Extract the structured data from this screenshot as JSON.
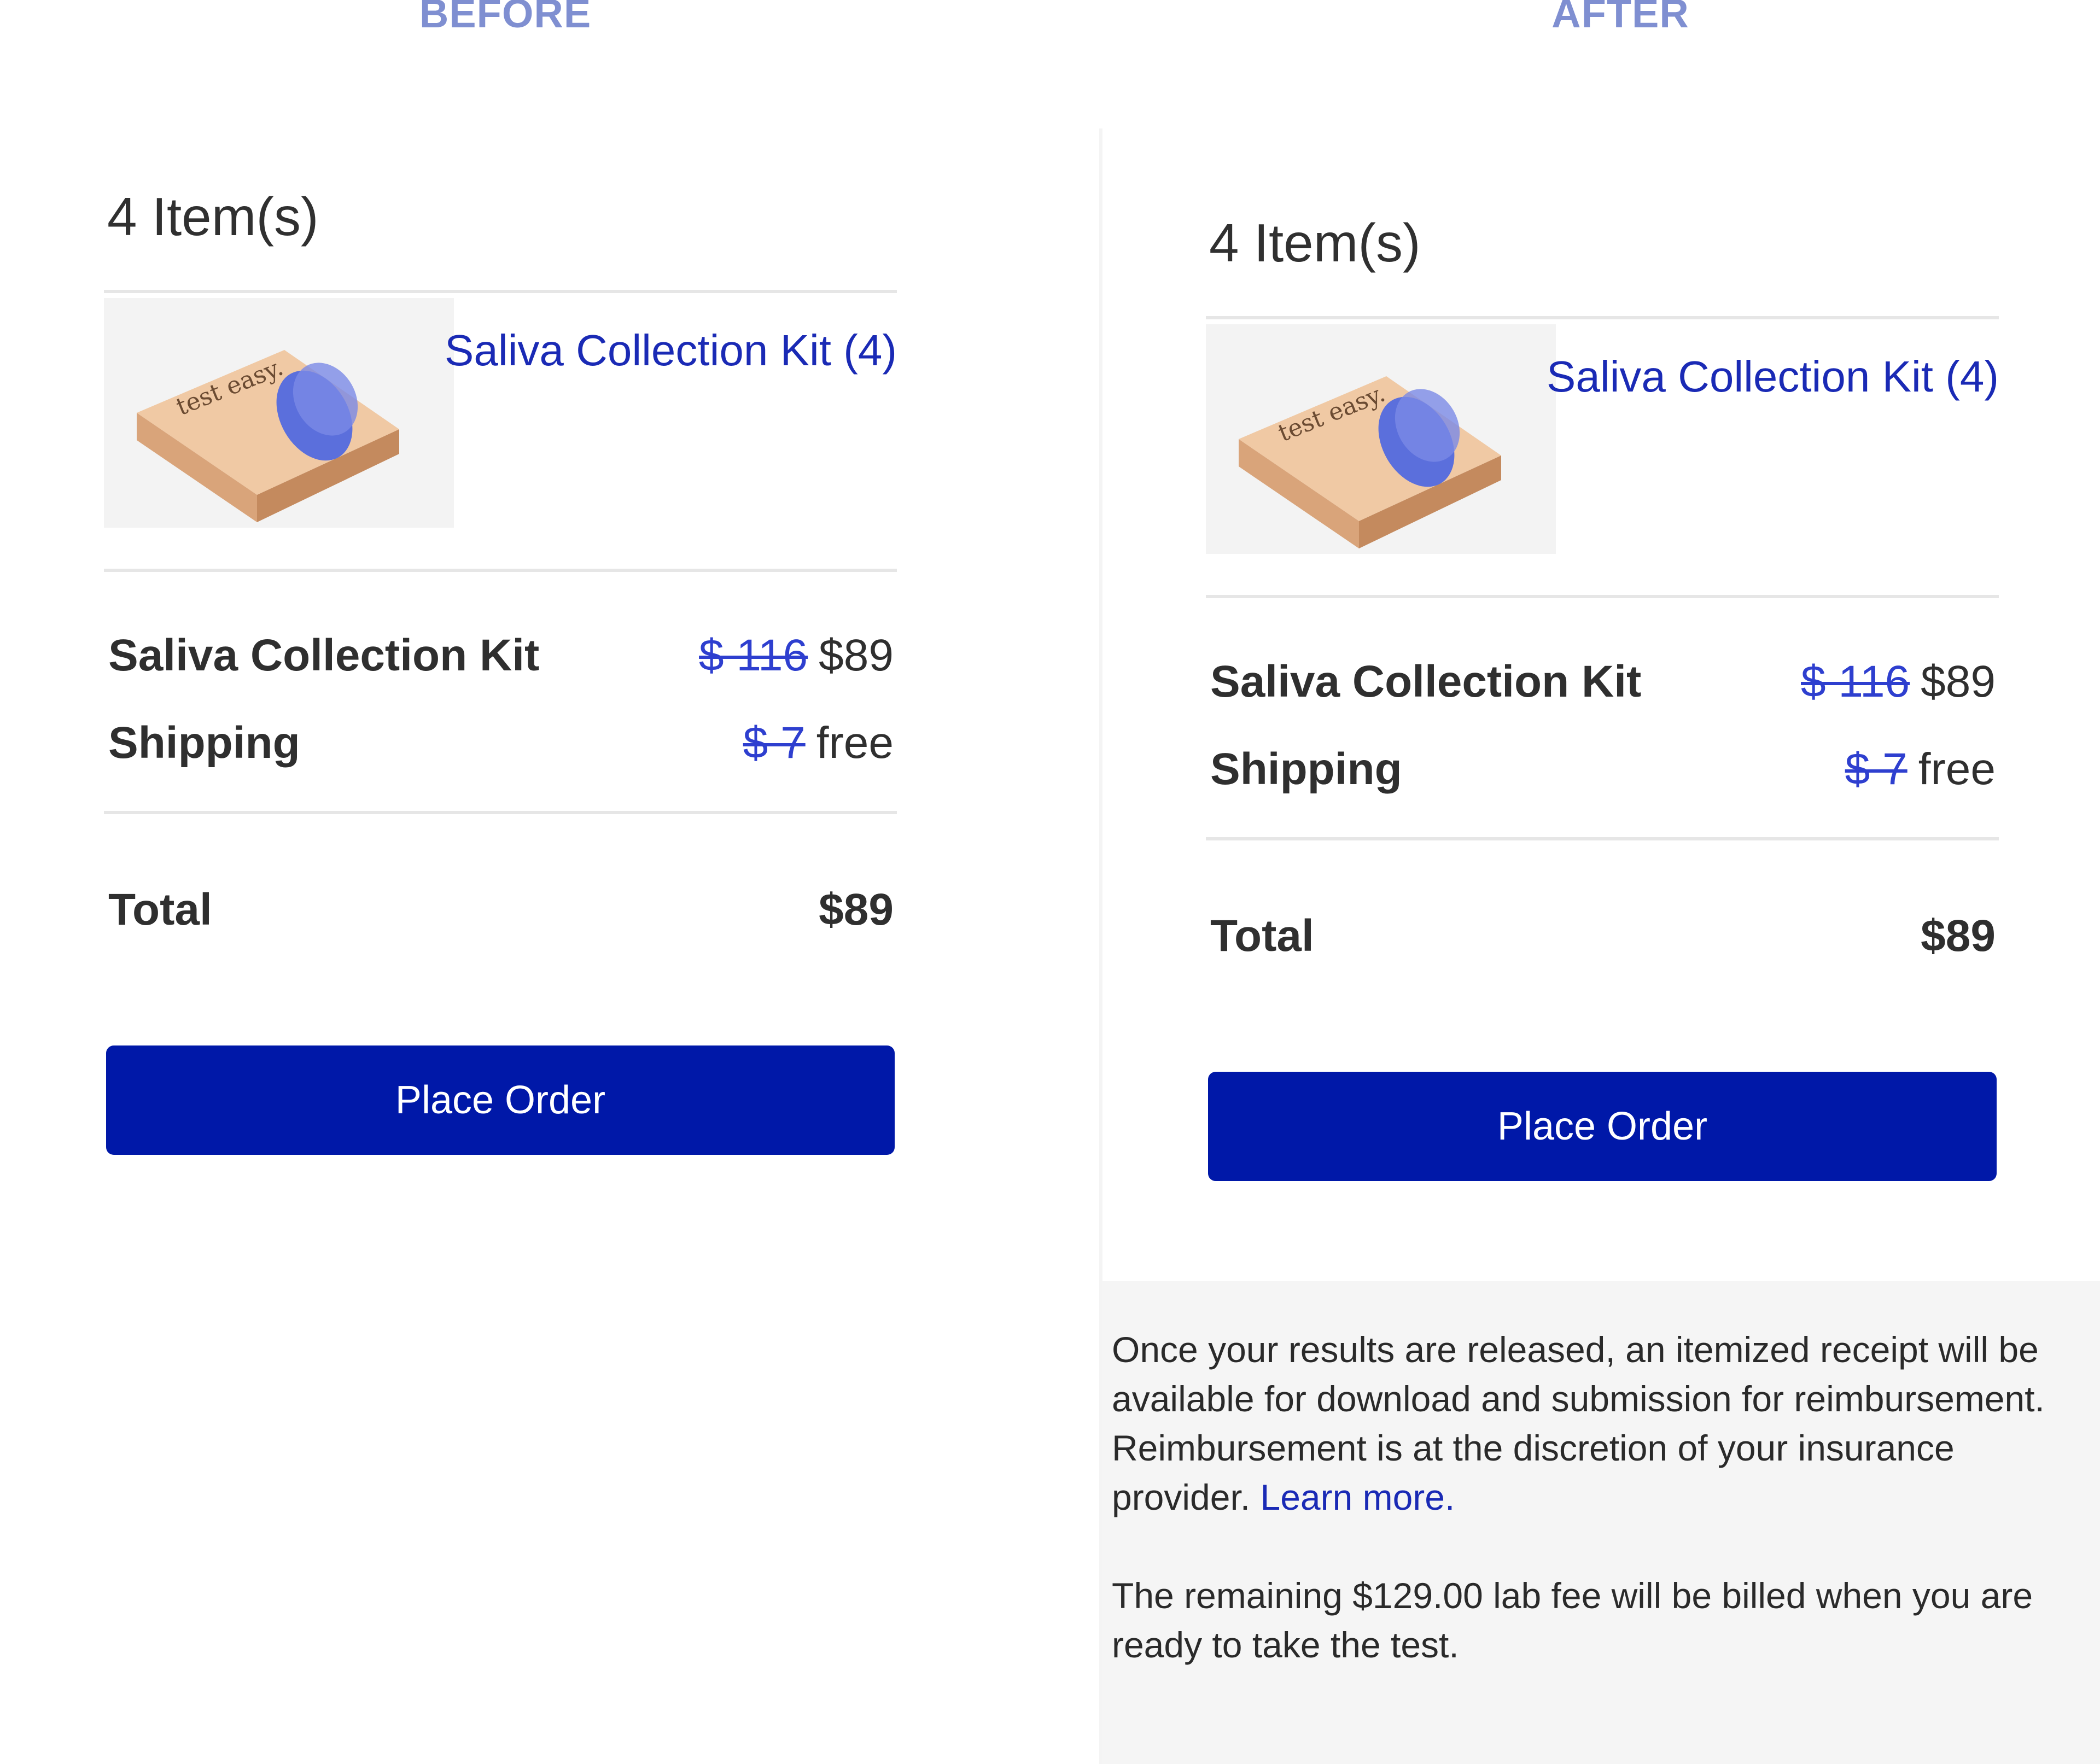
{
  "labels": {
    "before": "BEFORE",
    "after": "AFTER"
  },
  "cart": {
    "items_title": "4 Item(s)",
    "product_link": "Saliva Collection Kit (4)",
    "box_text": "test easy.",
    "line_items": [
      {
        "name": "Saliva Collection Kit",
        "old_price": "$ 116",
        "price": "$89"
      },
      {
        "name": "Shipping",
        "old_price": "$ 7",
        "price": "free"
      }
    ],
    "total_label": "Total",
    "total_value": "$89",
    "place_order_label": "Place Order"
  },
  "info": {
    "paragraph1": "Once your results are released, an itemized receipt will be available for download and submission for reimbursement. Reimbursement is at the discretion of your insurance provider.",
    "learn_more": "Learn more.",
    "paragraph2": "The remaining $129.00 lab fee will be billed when you are ready to take the test."
  },
  "colors": {
    "accent": "#0018a8",
    "link": "#1a2ab5",
    "label": "#7f8fd1",
    "box": "#f0c9a4",
    "box_accent": "#5b6fdc"
  }
}
